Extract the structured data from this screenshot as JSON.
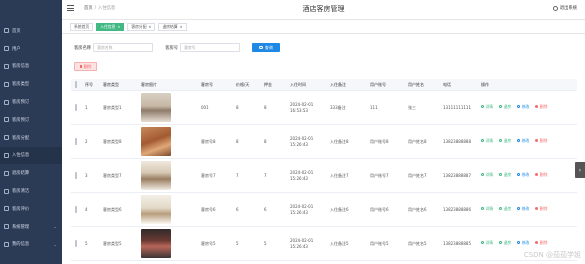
{
  "sidebar": {
    "items": [
      {
        "label": "首页",
        "icon": "home-icon"
      },
      {
        "label": "用户",
        "icon": "user-icon"
      },
      {
        "label": "客房信息",
        "icon": "room-icon"
      },
      {
        "label": "客房类型",
        "icon": "category-icon"
      },
      {
        "label": "客房预订",
        "icon": "booking-icon"
      },
      {
        "label": "客房预订",
        "icon": "order-icon"
      },
      {
        "label": "客房分配",
        "icon": "assign-icon"
      },
      {
        "label": "入住信息",
        "icon": "checkin-icon",
        "active": true
      },
      {
        "label": "退房结算",
        "icon": "checkout-icon"
      },
      {
        "label": "客房清洁",
        "icon": "clean-icon"
      },
      {
        "label": "客房评价",
        "icon": "review-icon"
      },
      {
        "label": "系统管理",
        "icon": "settings-icon",
        "has_children": true
      },
      {
        "label": "我的信息",
        "icon": "profile-icon",
        "has_children": true
      }
    ]
  },
  "topbar": {
    "crumb_home": "首页",
    "crumb_current": "入住信息",
    "system_title": "酒店客房管理",
    "logout_label": "退出系统"
  },
  "tabs": [
    {
      "label": "系统首页",
      "active": false
    },
    {
      "label": "入住信息",
      "active": true
    },
    {
      "label": "客房分配",
      "active": false
    },
    {
      "label": "退房结算",
      "active": false
    }
  ],
  "search": {
    "field1_label": "客房名称",
    "field1_placeholder": "客房名称",
    "field2_label": "客房号",
    "field2_placeholder": "客房号",
    "button_label": "查询"
  },
  "delete_button_label": "删除",
  "table": {
    "headers": [
      "",
      "序号",
      "客房类型",
      "客房图片",
      "客房号",
      "价格/天",
      "押金",
      "入住时间",
      "入住备注",
      "用户账号",
      "用户姓名",
      "电话",
      "操作"
    ],
    "rows": [
      {
        "idx": "1",
        "type": "客房类型1",
        "room_no": "001",
        "price": "8",
        "deposit": "8",
        "time": "2024-02-01 16:53:53",
        "note": "333备注",
        "account": "111",
        "name": "张三",
        "phone": "13111111111"
      },
      {
        "idx": "2",
        "type": "客房类型8",
        "room_no": "客房号8",
        "price": "8",
        "deposit": "8",
        "time": "2024-02-01 15:26:43",
        "note": "入住备注8",
        "account": "用户账号8",
        "name": "用户姓名8",
        "phone": "13823888888"
      },
      {
        "idx": "3",
        "type": "客房类型7",
        "room_no": "客房号7",
        "price": "7",
        "deposit": "7",
        "time": "2024-02-01 15:26:43",
        "note": "入住备注7",
        "account": "用户账号7",
        "name": "用户姓名7",
        "phone": "13823888887"
      },
      {
        "idx": "4",
        "type": "客房类型6",
        "room_no": "客房号6",
        "price": "6",
        "deposit": "6",
        "time": "2024-02-01 15:26:43",
        "note": "入住备注6",
        "account": "用户账号6",
        "name": "用户姓名6",
        "phone": "13823888886"
      },
      {
        "idx": "5",
        "type": "客房类型5",
        "room_no": "客房号5",
        "price": "5",
        "deposit": "5",
        "time": "2024-02-01 15:26:43",
        "note": "入住备注5",
        "account": "用户账号5",
        "name": "用户姓名5",
        "phone": "13823888885"
      }
    ],
    "ops": {
      "detail": "详情",
      "add": "退房",
      "edit": "修改",
      "del": "删除"
    }
  },
  "watermark": "CSDN @茄茄学姐",
  "colors": {
    "sidebar": "#2b3a55",
    "accent": "#42b983",
    "primary": "#1e88e5",
    "danger": "#f56c6c"
  }
}
